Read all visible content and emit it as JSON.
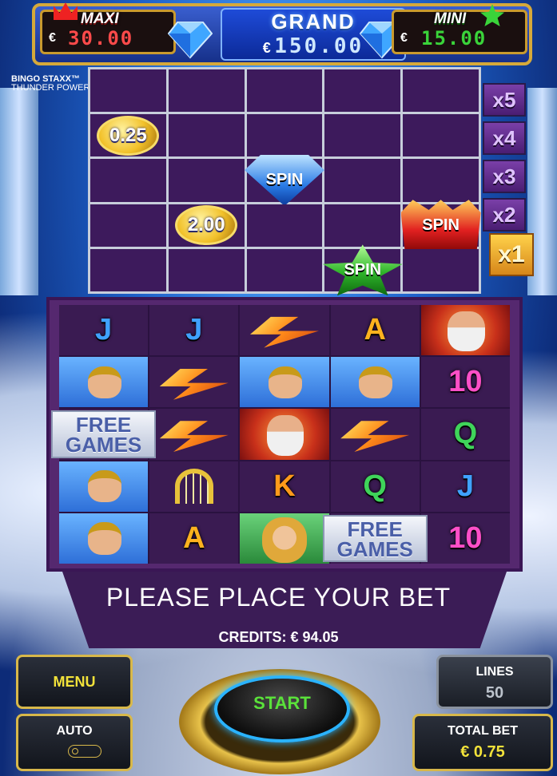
{
  "jackpots": {
    "maxi": {
      "label": "MAXI",
      "currency": "€",
      "value": "30.00"
    },
    "grand": {
      "label": "GRAND",
      "currency": "€",
      "value": "150.00"
    },
    "mini": {
      "label": "MINI",
      "currency": "€",
      "value": "15.00"
    }
  },
  "logo": {
    "line1": "BINGO STAXX™",
    "line2": "THUNDER POWER"
  },
  "bingo_grid": {
    "rows": 5,
    "cols": 5,
    "tokens": [
      {
        "row": 1,
        "col": 0,
        "type": "coin",
        "label": "0.25"
      },
      {
        "row": 2,
        "col": 2,
        "type": "spin-blue",
        "label": "SPIN"
      },
      {
        "row": 3,
        "col": 1,
        "type": "coin",
        "label": "2.00"
      },
      {
        "row": 3,
        "col": 4,
        "type": "spin-red",
        "label": "SPIN"
      },
      {
        "row": 4,
        "col": 3,
        "type": "spin-green",
        "label": "SPIN"
      }
    ]
  },
  "multipliers": [
    "x5",
    "x4",
    "x3",
    "x2",
    "x1"
  ],
  "active_multiplier": "x1",
  "reels": [
    [
      "J",
      "J",
      "bolt",
      "A",
      "zeus"
    ],
    [
      "hero",
      "bolt",
      "hero",
      "hero",
      "10"
    ],
    [
      "FREE GAMES",
      "bolt",
      "zeus",
      "bolt",
      "Q"
    ],
    [
      "hero",
      "harp",
      "K",
      "Q",
      "J"
    ],
    [
      "hero",
      "A",
      "goddess",
      "FREE GAMES",
      "10"
    ]
  ],
  "message": "PLEASE PLACE YOUR BET",
  "credits": "CREDITS: € 94.05",
  "controls": {
    "menu": "MENU",
    "auto": "AUTO",
    "start": "START",
    "lines_label": "LINES",
    "lines_value": "50",
    "total_bet_label": "TOTAL BET",
    "total_bet_value": "€ 0.75"
  },
  "colors": {
    "accent_gold": "#d8b84a",
    "start_green": "#5ae23a",
    "maxi_red": "#ff4a4a",
    "mini_green": "#3ad43a",
    "grand_blue": "#cfe8ff"
  },
  "icons": [
    "crown-icon",
    "star-icon",
    "diamond-icon",
    "lightning-bolt-icon",
    "harp-icon"
  ]
}
